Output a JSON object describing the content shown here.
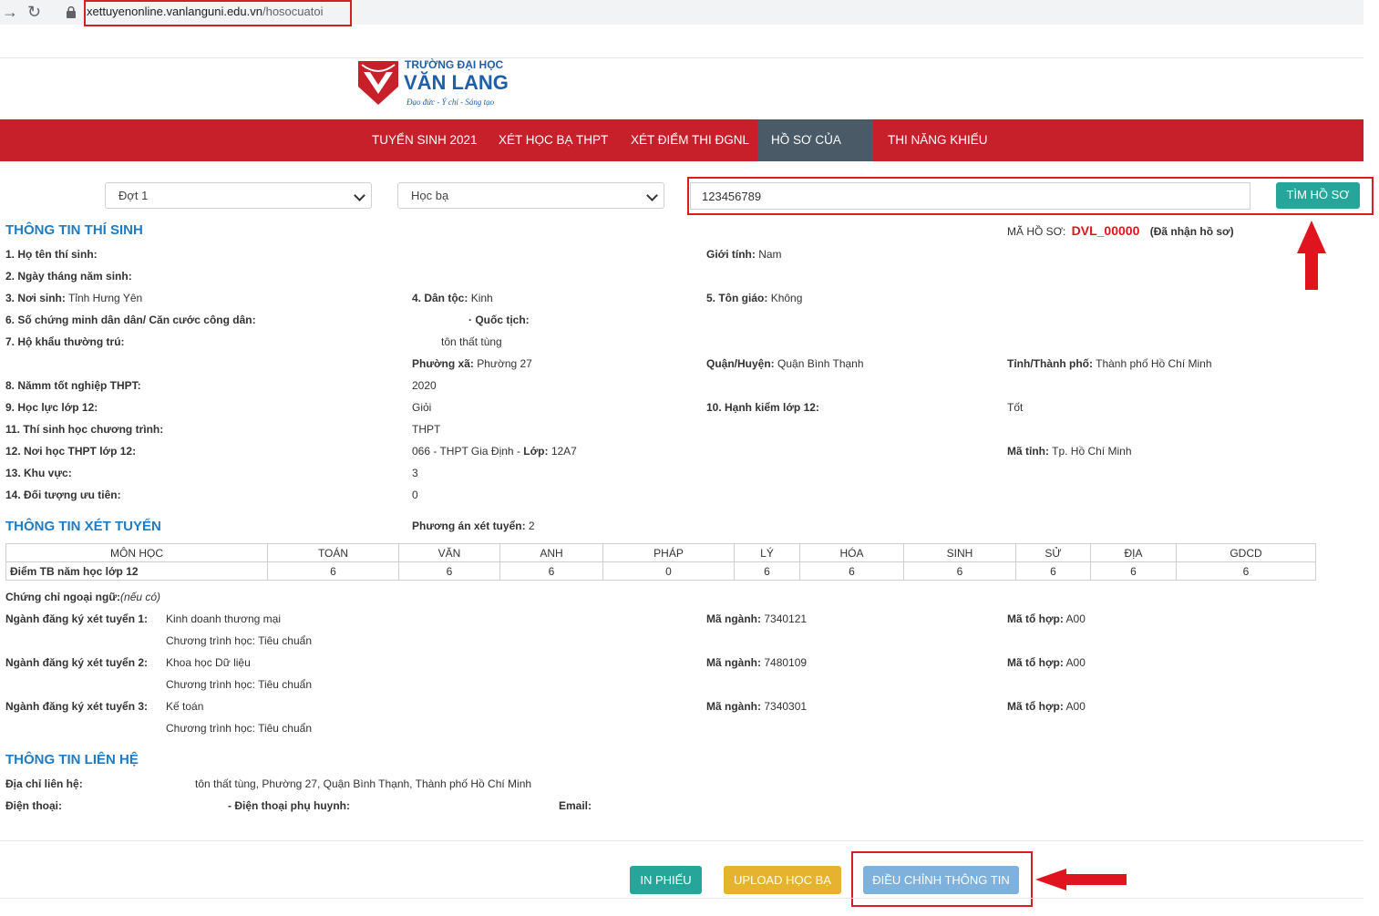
{
  "browser": {
    "back_icon": "arrow-left-icon",
    "reload_icon": "reload-icon",
    "lock_icon": "lock-icon",
    "url_host": "xettuyenonline.vanlanguni.edu.vn",
    "url_path": "/hosocuatoi"
  },
  "logo": {
    "line1": "TRƯỜNG ĐẠI HỌC",
    "line2": "VĂN LANG",
    "tagline": "Đạo đức - Ý chí - Sáng tạo",
    "color": "#c8202a"
  },
  "nav": {
    "items": [
      "TUYỂN SINH 2021",
      "XÉT HỌC BẠ THPT",
      "XÉT ĐIỂM THI ĐGNL",
      "HỒ SƠ CỦA TÔI",
      "THI NĂNG KHIẾU"
    ],
    "active": "HỒ SƠ CỦA TÔI"
  },
  "search": {
    "round": "Đợt 1",
    "type": "Học bạ",
    "value": "123456789",
    "button": "TÌM HỒ SƠ"
  },
  "candidate": {
    "title": "THÔNG TIN THÍ SINH",
    "code_label": "MÃ HỒ SƠ:",
    "code": "DVL_00000",
    "status": "(Đã nhận hồ sơ)",
    "name_label": "1. Họ tên thí sinh:",
    "gender_label": "Giới tính:",
    "gender": "Nam",
    "dob_label": "2. Ngày tháng năm sinh:",
    "pob_label": "3. Nơi sinh:",
    "pob": "Tỉnh Hưng Yên",
    "ethnic_label": "4. Dân tộc:",
    "ethnic": "Kinh",
    "religion_label": "5. Tôn giáo:",
    "religion": "Không",
    "id_label": "6. Số chứng minh dân dân/ Căn cước công dân:",
    "nationality_label": "· Quốc tịch:",
    "residence_label": "7. Hộ khẩu thường trú:",
    "residence": "tôn thất tùng",
    "ward_label": "Phường xã:",
    "ward": "Phường 27",
    "district_label": "Quận/Huyện:",
    "district": "Quận Bình Thạnh",
    "province_label": "Tỉnh/Thành phố:",
    "province": "Thành phố Hồ Chí Minh",
    "grad_label": "8. Nămm tốt nghiệp THPT:",
    "grad": "2020",
    "academic_label": "9. Học lực lớp 12:",
    "academic": "Giỏi",
    "conduct_label": "10. Hạnh kiểm lớp 12:",
    "conduct": "Tốt",
    "program_label": "11. Thí sinh học chương trình:",
    "program": "THPT",
    "school_label": "12. Nơi học THPT lớp 12:",
    "school": "066 - THPT Gia Định -",
    "class_label": "Lớp:",
    "class": "12A7",
    "school_prov_label": "Mã tỉnh:",
    "school_prov": "Tp. Hồ Chí Minh",
    "area_label": "13. Khu vực:",
    "area": "3",
    "priority_label": "14. Đối tượng ưu tiên:",
    "priority": "0"
  },
  "admission": {
    "title": "THÔNG TIN XÉT TUYỂN",
    "method_label": "Phương án xét tuyển:",
    "method": "2",
    "table_header": [
      "MÔN HỌC",
      "TOÁN",
      "VĂN",
      "ANH",
      "PHÁP",
      "LÝ",
      "HÓA",
      "SINH",
      "SỬ",
      "ĐỊA",
      "GDCD"
    ],
    "table_row": [
      "Điểm TB năm học lớp 12",
      "6",
      "6",
      "6",
      "0",
      "6",
      "6",
      "6",
      "6",
      "6",
      "6"
    ],
    "cert_label": "Chứng chỉ ngoại ngữ:",
    "cert_note": "(nếu có)",
    "choices": [
      {
        "label": "Ngành đăng ký xét tuyển 1:",
        "major": "Kinh doanh thương mại",
        "program": "Chương trình học: Tiêu chuẩn",
        "code_label": "Mã ngành:",
        "code": "7340121",
        "combo_label": "Mã tổ hợp:",
        "combo": "A00"
      },
      {
        "label": "Ngành đăng ký xét tuyển 2:",
        "major": "Khoa học Dữ liệu",
        "program": "Chương trình học: Tiêu chuẩn",
        "code_label": "Mã ngành:",
        "code": "7480109",
        "combo_label": "Mã tổ hợp:",
        "combo": "A00"
      },
      {
        "label": "Ngành đăng ký xét tuyển 3:",
        "major": "Kế toán",
        "program": "Chương trình học: Tiêu chuẩn",
        "code_label": "Mã ngành:",
        "code": "7340301",
        "combo_label": "Mã tổ hợp:",
        "combo": "A00"
      }
    ]
  },
  "contact": {
    "title": "THÔNG TIN LIÊN HỆ",
    "address_label": "Địa chỉ liên hệ:",
    "address": "tôn thất tùng, Phường 27, Quận Bình Thạnh, Thành phố Hồ Chí Minh",
    "phone_label": "Điện thoại:",
    "parent_phone_label": "- Điện thoại phụ huynh:",
    "email_label": "Email:"
  },
  "actions": {
    "print": "IN PHIẾU",
    "upload": "UPLOAD HỌC BẠ",
    "edit": "ĐIỀU CHỈNH THÔNG TIN"
  },
  "colors": {
    "nav_red": "#c8202a",
    "nav_active": "#4a5a66",
    "teal": "#26a69a",
    "gold": "#e6b32e",
    "light_blue": "#7fb1dd",
    "title_blue": "#1f7cc4",
    "code_red": "#e0141e"
  }
}
